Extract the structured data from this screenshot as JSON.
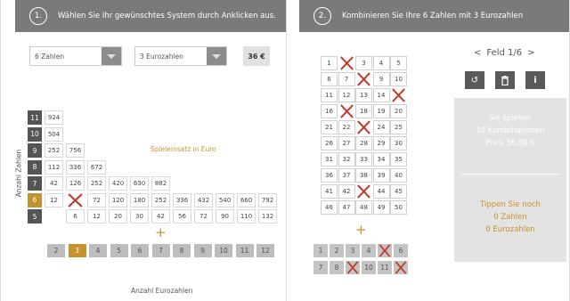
{
  "step1": {
    "number": "1.",
    "title": "Wählen Sie Ihr gewünschtes System durch Anklicken aus."
  },
  "step2": {
    "number": "2.",
    "title": "Kombinieren Sie Ihre 6 Zahlen mit 3 Eurozahlen"
  },
  "select_numbers": {
    "value": "6 Zahlen"
  },
  "select_euro": {
    "value": "3 Eurozahlen"
  },
  "price": "36 €",
  "y_axis_label": "Anzahl Zahlen",
  "x_axis_label": "Anzahl Eurozahlen",
  "table_caption": "Spieleinsatz in Euro",
  "plus_sign": "+",
  "row_labels": [
    "11",
    "10",
    "9",
    "8",
    "7",
    "6",
    "5"
  ],
  "active_row": "6",
  "table_rows": [
    [
      "924"
    ],
    [
      "504"
    ],
    [
      "252",
      "756"
    ],
    [
      "112",
      "336",
      "672"
    ],
    [
      "42",
      "126",
      "252",
      "420",
      "630",
      "882"
    ],
    [
      "12",
      "",
      "72",
      "120",
      "180",
      "252",
      "336",
      "432",
      "540",
      "660",
      "792"
    ],
    [
      "",
      "6",
      "12",
      "20",
      "30",
      "42",
      "56",
      "72",
      "90",
      "110",
      "132"
    ]
  ],
  "euro_columns": [
    "2",
    "3",
    "4",
    "5",
    "6",
    "7",
    "8",
    "9",
    "10",
    "11",
    "12"
  ],
  "active_euro_column": "3",
  "lotto_numbers": [
    "1",
    "2",
    "3",
    "4",
    "5",
    "6",
    "7",
    "8",
    "9",
    "10",
    "11",
    "12",
    "13",
    "14",
    "15",
    "16",
    "17",
    "18",
    "19",
    "20",
    "21",
    "22",
    "23",
    "24",
    "25",
    "26",
    "27",
    "28",
    "29",
    "30",
    "31",
    "32",
    "33",
    "34",
    "35",
    "36",
    "37",
    "38",
    "39",
    "40",
    "41",
    "42",
    "43",
    "44",
    "45",
    "46",
    "47",
    "48",
    "49",
    "50"
  ],
  "crossed_numbers": [
    "2",
    "8",
    "15",
    "17",
    "23",
    "43"
  ],
  "euro_numbers": [
    "1",
    "2",
    "3",
    "4",
    "5",
    "6",
    "7",
    "8",
    "9",
    "10",
    "11",
    "12"
  ],
  "crossed_euro": [
    "5",
    "9",
    "12"
  ],
  "field_nav": {
    "prev": "<",
    "label": "Feld 1/6",
    "next": ">"
  },
  "icons": {
    "reset": "↺",
    "delete": "🗑",
    "info": "i"
  },
  "summary": {
    "line1": "Sie spielen:",
    "line2": "18 Kombinationen",
    "line3": "Preis 36,00 €",
    "hint1": "Tippen Sie noch",
    "hint2": "0 Zahlen",
    "hint3": "0 Eurozahlen"
  },
  "colors": {
    "header": "#7a7a7a",
    "accent": "#c6922d",
    "dark": "#555555",
    "cross": "#c0392b"
  }
}
